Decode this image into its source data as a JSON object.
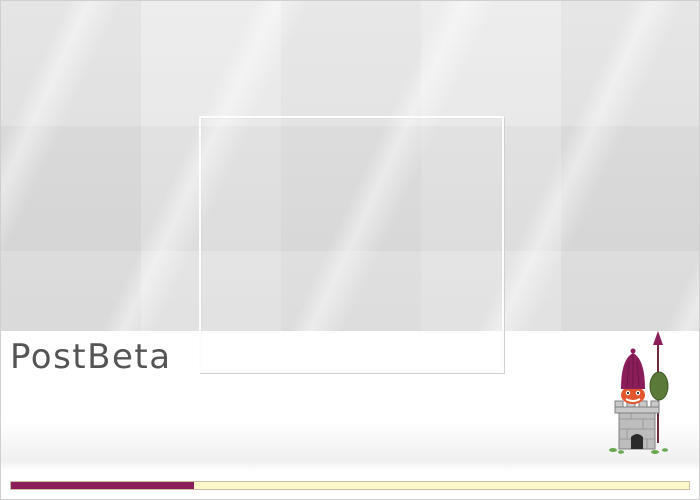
{
  "app": {
    "brand_name": "PostBeta"
  },
  "progress": {
    "fraction": 0.27,
    "fill_color": "#8b1e5a",
    "track_color": "#fff6c9"
  },
  "mascot": {
    "icon": "tower-guard-icon"
  }
}
